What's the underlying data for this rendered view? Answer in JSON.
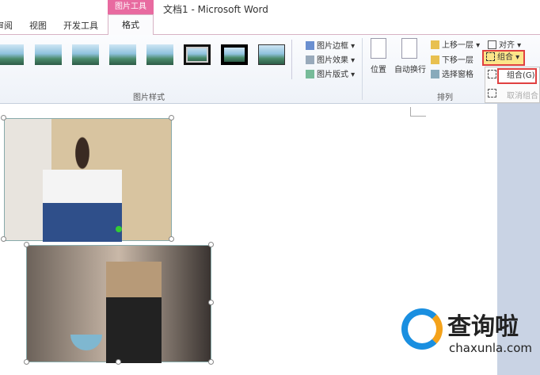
{
  "window": {
    "title": "文档1 - Microsoft Word",
    "context_tab": "图片工具"
  },
  "tabs": [
    {
      "label": "审阅"
    },
    {
      "label": "视图"
    },
    {
      "label": "开发工具"
    },
    {
      "label": "格式",
      "active": true
    }
  ],
  "ribbon": {
    "picture_styles": {
      "label": "图片样式",
      "buttons": [
        "图片边框",
        "图片效果",
        "图片版式"
      ]
    },
    "arrange": {
      "label": "排列",
      "position": "位置",
      "wrap": "自动换行",
      "bring_forward": "上移一层",
      "send_backward": "下移一层",
      "selection_pane": "选择窗格",
      "align": "对齐",
      "group": "组合"
    }
  },
  "group_menu": {
    "items": [
      {
        "label": "组合(G)",
        "highlighted": true
      },
      {
        "label": "取消组合",
        "disabled": true
      }
    ]
  },
  "watermark": {
    "brand": "查询啦",
    "url": "chaxunla.com"
  },
  "colors": {
    "accent": "#e86aa0",
    "highlight": "#fce58a",
    "outline": "#e04040"
  }
}
